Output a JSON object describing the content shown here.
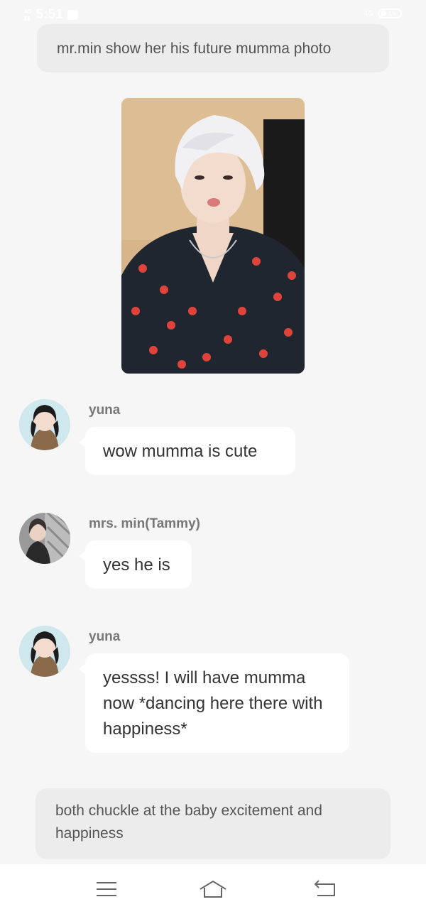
{
  "status_bar": {
    "network_top": "4G",
    "time": "5:51",
    "right_network": "4G",
    "battery_percent": "15"
  },
  "narration_top": "mr.min show her his future mumma photo",
  "photo": {
    "type": "shared-photo"
  },
  "messages": [
    {
      "sender": "yuna",
      "text": "wow mumma is cute"
    },
    {
      "sender": "mrs. min(Tammy)",
      "text": "yes he is"
    },
    {
      "sender": "yuna",
      "text": "yessss! I will have mumma now *dancing here there with happiness*"
    }
  ],
  "narration_bottom": "both chuckle at the baby excitement and happiness",
  "nav": {
    "menu_icon": "menu-icon",
    "home_icon": "home-icon",
    "back_icon": "back-icon"
  },
  "colors": {
    "background": "#f6f6f6",
    "bubble": "#ffffff",
    "narration": "#ececec",
    "sender": "#777777"
  }
}
